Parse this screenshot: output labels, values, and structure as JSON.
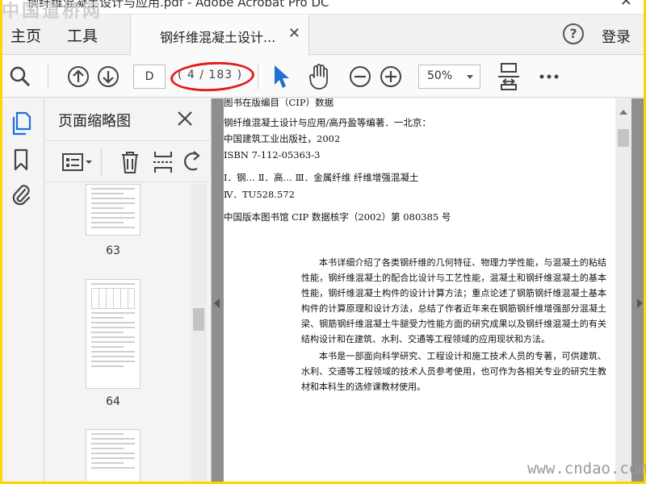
{
  "window": {
    "title": "钢纤维混凝土设计与应用.pdf - Adobe Acrobat Pro DC",
    "close": "✕"
  },
  "menubar": {
    "home": "主页",
    "tools": "工具",
    "doc_tab": "钢纤维混凝土设计...",
    "doc_tab_close": "✕",
    "help": "?",
    "login": "登录"
  },
  "toolbar": {
    "page_input": "D",
    "page_count": "( 4 / 183 )",
    "zoom": "50%"
  },
  "thumbnails": {
    "title": "页面缩略图",
    "pages": [
      "63",
      "64"
    ]
  },
  "document": {
    "cip_lines": [
      "图书在版编目（CIP）数据",
      "钢纤维混凝土设计与应用/高丹盈等编著．一北京：",
      "中国建筑工业出版社，2002",
      "ISBN 7-112-05363-3",
      "Ⅰ．钢…  Ⅱ．高…  Ⅲ．金属纤维 纤维增强混凝土",
      "Ⅳ．TU528.572",
      "中国版本图书馆 CIP 数据核字（2002）第 080385 号"
    ],
    "intro_paragraphs": [
      "本书详细介绍了各类钢纤维的几何特征、物理力学性能，与混凝土的粘结性能，钢纤维混凝土的配合比设计与工艺性能，混凝土和钢纤维混凝土的基本性能，钢纤维混凝土构件的设计计算方法；重点论述了钢筋钢纤维混凝土基本构件的计算原理和设计方法，总结了作者近年来在钢筋钢纤维增强部分混凝土梁、钢筋钢纤维混凝土牛腿受力性能方面的研究成果以及钢纤维混凝土的有关结构设计和在建筑、水利、交通等工程领域的应用现状和方法。",
      "本书是一部面向科学研究、工程设计和施工技术人员的专著，可供建筑、水利、交通等工程领域的技术人员参考使用，也可作为各相关专业的研究生教材和本科生的选修课教材使用。"
    ]
  },
  "watermarks": {
    "top_left": "中国道桥网",
    "bottom_right": "www.cndao.com"
  },
  "colors": {
    "accent_blue": "#1f6fd6",
    "annotation_red": "#e01d1d",
    "border_yellow": "#ffd400"
  }
}
